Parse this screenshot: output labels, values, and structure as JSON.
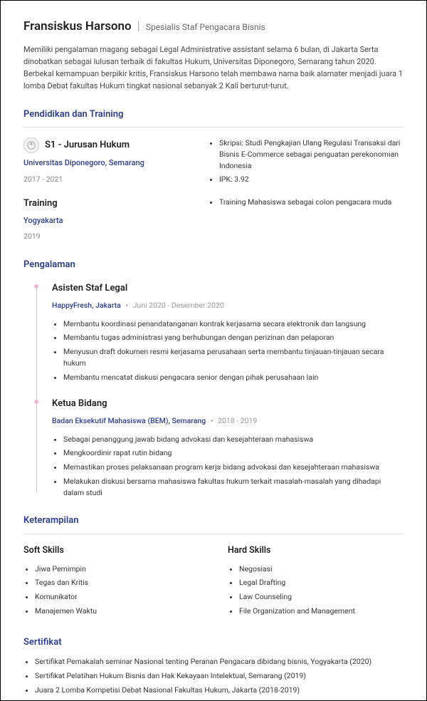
{
  "header": {
    "name": "Fransiskus Harsono",
    "subtitle": "Spesialis Staf Pengacara Bisnis"
  },
  "summary": "Memiliki pengalaman magang sebagai Legal Administrative assistant selama 6 bulan, di Jakarta Serta dinobatkan sebagai lulusan terbaik di fakultas Hukum, Universitas Diponegoro, Semarang tahun 2020. Berbekal kemampuan berpikir kritis, Fransiskus Harsono telah membawa nama baik alamater menjadi juara 1 lomba Debat fakultas Hukum tingkat nasional sebanyak 2 Kali berturut-turut.",
  "education": {
    "title": "Pendidikan dan Training",
    "items": [
      {
        "degree": "S1 - Jurusan Hukum",
        "institution": "Universitas Diponegoro, Semarang",
        "dates": "2017 - 2021",
        "bullets": [
          "Skripsi: Studi Pengkajian Ulang Regulasi Transaksi dari Bisnis E-Commerce sebagai penguatan perekonomian Indonesia",
          "IPK: 3.92"
        ]
      },
      {
        "degree": "Training",
        "institution": "Yogyakarta",
        "dates": "2019",
        "bullets": [
          "Training Mahasiswa sebagai colon pengacara muda"
        ]
      }
    ]
  },
  "experience": {
    "title": "Pengalaman",
    "items": [
      {
        "role": "Asisten Staf Legal",
        "company": "HappyFresh, Jakarta",
        "dates": "Juni 2020 - Desember 2020",
        "bullets": [
          "Membantu koordinasi penandatanganan kontrak kerjasama secara elektronik dan langsung",
          "Membantu tugas administrasi yang berhubungan dengan perizinan dan pelaporan",
          "Menyusun draft dokumen resmi kerjasama perusahaan serta membantu tinjauan-tinjauan secara hukum",
          "Membantu mencatat diskusi pengacara senior dengan pihak perusahaan lain"
        ]
      },
      {
        "role": "Ketua Bidang",
        "company": "Badan Eksekutif Mahasiswa (BEM), Semarang",
        "dates": "2018 - 2019",
        "bullets": [
          "Sebagai penanggung jawab bidang advokasi dan kesejahteraan mahasiswa",
          "Mengkoordinir rapat rutin bidang",
          "Memastikan proses pelaksanaan program kerja bidang advokasi dan kesejahteraan mahasiswa",
          "Melakukan diskusi bersama mahasiswa fakultas hukum terkait masalah-masalah yang dihadapi dalam studi"
        ]
      }
    ]
  },
  "skills": {
    "title": "Keterampilan",
    "soft": {
      "heading": "Soft Skills",
      "items": [
        "Jiwa Pemimpin",
        "Tegas dan Kritis",
        "Komunikator",
        "Manajemen Waktu"
      ]
    },
    "hard": {
      "heading": "Hard Skills",
      "items": [
        "Negosiasi",
        "Legal Drafting",
        "Law Counseling",
        "File Organization and Management"
      ]
    }
  },
  "certs": {
    "title": "Sertifikat",
    "items": [
      "Sertifikat Pemakalah seminar Nasional tenting Peranan Pengacara dibidang bisnis, Yogyakarta (2020)",
      "Sertifikat Pelatihan Hukum Bisnis dan Hak Kekayaan Intelektual, Semarang (2019)",
      "Juara 2 Lomba Kompetisi Debat Nasional Fakultas Hukum, Jakarta (2018-2019)"
    ]
  }
}
